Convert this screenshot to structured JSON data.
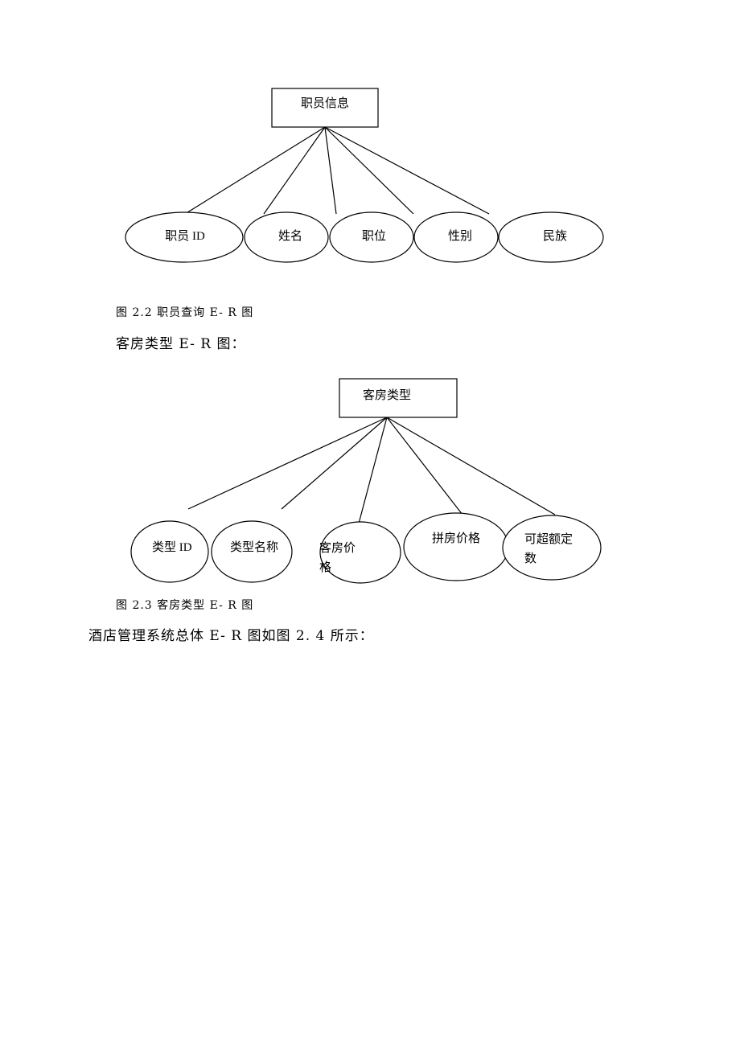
{
  "diagram1": {
    "entity": "职员信息",
    "attributes": [
      "职员 ID",
      "姓名",
      "职位",
      "性别",
      "民族"
    ]
  },
  "caption1": "图 2.2 职员查询 E- R 图",
  "para1": "客房类型 E- R 图：",
  "diagram2": {
    "entity": "客房类型",
    "attributes": [
      {
        "line1": "类型 ID",
        "line2": ""
      },
      {
        "line1": "类型名称",
        "line2": ""
      },
      {
        "line1": "客房价",
        "line2": "格"
      },
      {
        "line1": "拼房价格",
        "line2": ""
      },
      {
        "line1": "可超额定",
        "line2": "数"
      }
    ]
  },
  "caption2": "图 2.3 客房类型 E- R 图",
  "para2": "酒店管理系统总体 E- R 图如图 2. 4 所示："
}
